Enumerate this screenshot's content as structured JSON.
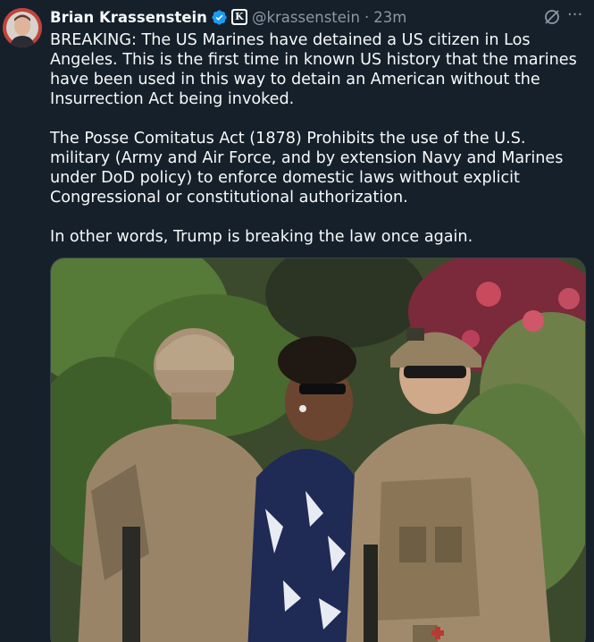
{
  "author": {
    "name": "Brian Krassenstein",
    "handle": "@krassenstein",
    "separator": "·",
    "time": "23m"
  },
  "icons": {
    "verified": "verified-badge-icon",
    "affiliate": "affiliate-k-badge-icon",
    "grok": "grok-slash-icon",
    "more": "more-dots-icon"
  },
  "affiliate_letter": "K",
  "more_glyph": "···",
  "body": {
    "paragraph_1": "BREAKING: The US Marines have detained a US citizen in Los Angeles. This is the first time in known US history that the marines have been used in this way to detain an American without the Insurrection Act being invoked.",
    "paragraph_2": "The Posse Comitatus Act (1878) Prohibits the use of the U.S. military (Army and Air Force, and by extension Navy and Marines under DoD policy) to enforce domestic laws without explicit Congressional or constitutional authorization.",
    "paragraph_3": "In other words, Trump is breaking the law once again."
  },
  "colors": {
    "background": "#15202b",
    "text": "#f7f9f9",
    "secondary": "#8b98a5",
    "verified": "#1d9bf0"
  }
}
